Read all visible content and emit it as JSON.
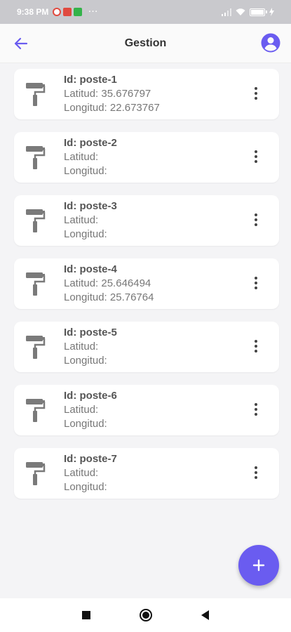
{
  "status_bar": {
    "time": "9:38 PM",
    "notification_icons": [
      "google-icon",
      "gmail-icon",
      "messaging-icon"
    ],
    "overflow": "···",
    "battery_level": 1.0
  },
  "app_bar": {
    "title": "Gestion",
    "back_icon": "arrow-left-icon",
    "account_icon": "account-circle-icon",
    "accent_color": "#6a5cf0"
  },
  "items": [
    {
      "id": "Id: poste-1",
      "lat": "Latitud: 35.676797",
      "lng": "Longitud: 22.673767"
    },
    {
      "id": "Id: poste-2",
      "lat": "Latitud:",
      "lng": "Longitud:"
    },
    {
      "id": "Id: poste-3",
      "lat": "Latitud:",
      "lng": "Longitud:"
    },
    {
      "id": "Id: poste-4",
      "lat": "Latitud: 25.646494",
      "lng": "Longitud: 25.76764"
    },
    {
      "id": "Id: poste-5",
      "lat": "Latitud:",
      "lng": "Longitud:"
    },
    {
      "id": "Id: poste-6",
      "lat": "Latitud:",
      "lng": "Longitud:"
    },
    {
      "id": "Id: poste-7",
      "lat": "Latitud:",
      "lng": "Longitud:"
    }
  ],
  "item_icon": "paint-roller-icon",
  "item_menu_icon": "more-vert-icon",
  "fab": {
    "icon": "plus-icon",
    "color": "#6a5cf0"
  },
  "nav_bar": {
    "buttons": [
      "recents-square",
      "home-circle",
      "back-triangle"
    ]
  }
}
